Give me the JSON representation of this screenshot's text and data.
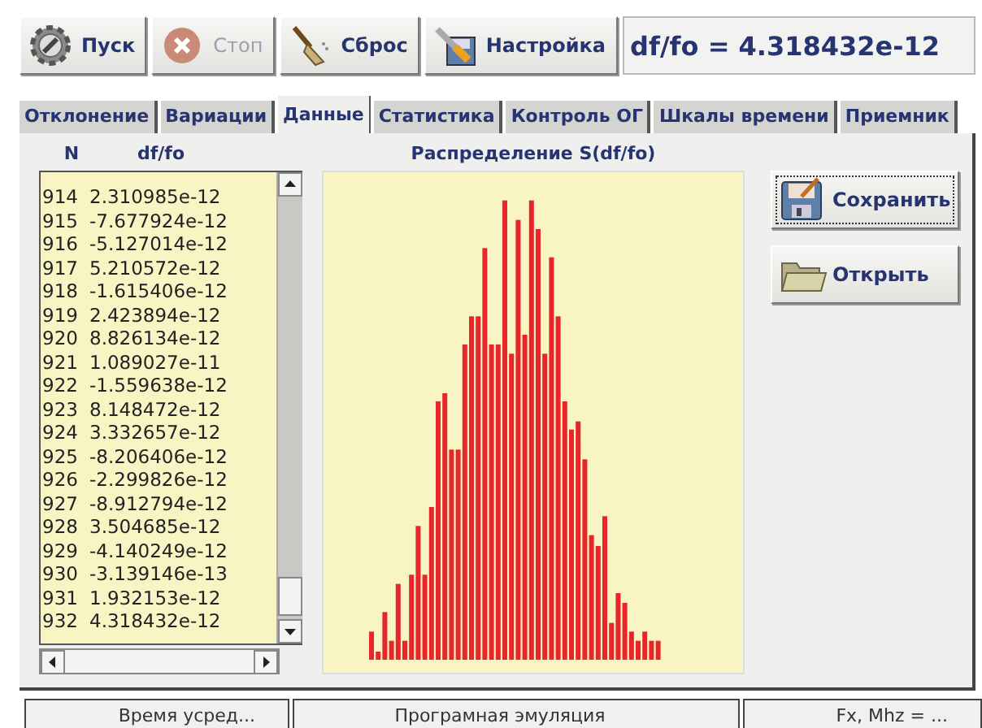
{
  "toolbar": {
    "buttons": [
      {
        "label": "Пуск",
        "disabled": false
      },
      {
        "label": "Стоп",
        "disabled": true
      },
      {
        "label": "Сброс",
        "disabled": false
      },
      {
        "label": "Настройка",
        "disabled": false
      }
    ],
    "readout": "df/fo = 4.318432e-12"
  },
  "tabs": [
    {
      "label": "Отклонение",
      "selected": false
    },
    {
      "label": "Вариации",
      "selected": false
    },
    {
      "label": "Данные",
      "selected": true
    },
    {
      "label": "Статистика",
      "selected": false
    },
    {
      "label": "Контроль ОГ",
      "selected": false
    },
    {
      "label": "Шкалы времени",
      "selected": false
    },
    {
      "label": "Приемник",
      "selected": false
    }
  ],
  "data_list": {
    "columns": [
      "N",
      "df/fo"
    ],
    "rows": [
      [
        "914",
        "2.310985e-12"
      ],
      [
        "915",
        "-7.677924e-12"
      ],
      [
        "916",
        "-5.127014e-12"
      ],
      [
        "917",
        "5.210572e-12"
      ],
      [
        "918",
        "-1.615406e-12"
      ],
      [
        "919",
        "2.423894e-12"
      ],
      [
        "920",
        "8.826134e-12"
      ],
      [
        "921",
        "1.089027e-11"
      ],
      [
        "922",
        "-1.559638e-12"
      ],
      [
        "923",
        "8.148472e-12"
      ],
      [
        "924",
        "3.332657e-12"
      ],
      [
        "925",
        "-8.206406e-12"
      ],
      [
        "926",
        "-2.299826e-12"
      ],
      [
        "927",
        "-8.912794e-12"
      ],
      [
        "928",
        "3.504685e-12"
      ],
      [
        "929",
        "-4.140249e-12"
      ],
      [
        "930",
        "-3.139146e-13"
      ],
      [
        "931",
        "1.932153e-12"
      ],
      [
        "932",
        "4.318432e-12"
      ]
    ]
  },
  "chart": {
    "title": "Распределение S(df/fo)"
  },
  "actions": [
    {
      "label": "Сохранить",
      "focused": true
    },
    {
      "label": "Открыть",
      "focused": false
    }
  ],
  "status_bar": [
    "Время усред...",
    "Програмная эмуляция",
    "Fx, Mhz = ..."
  ]
}
